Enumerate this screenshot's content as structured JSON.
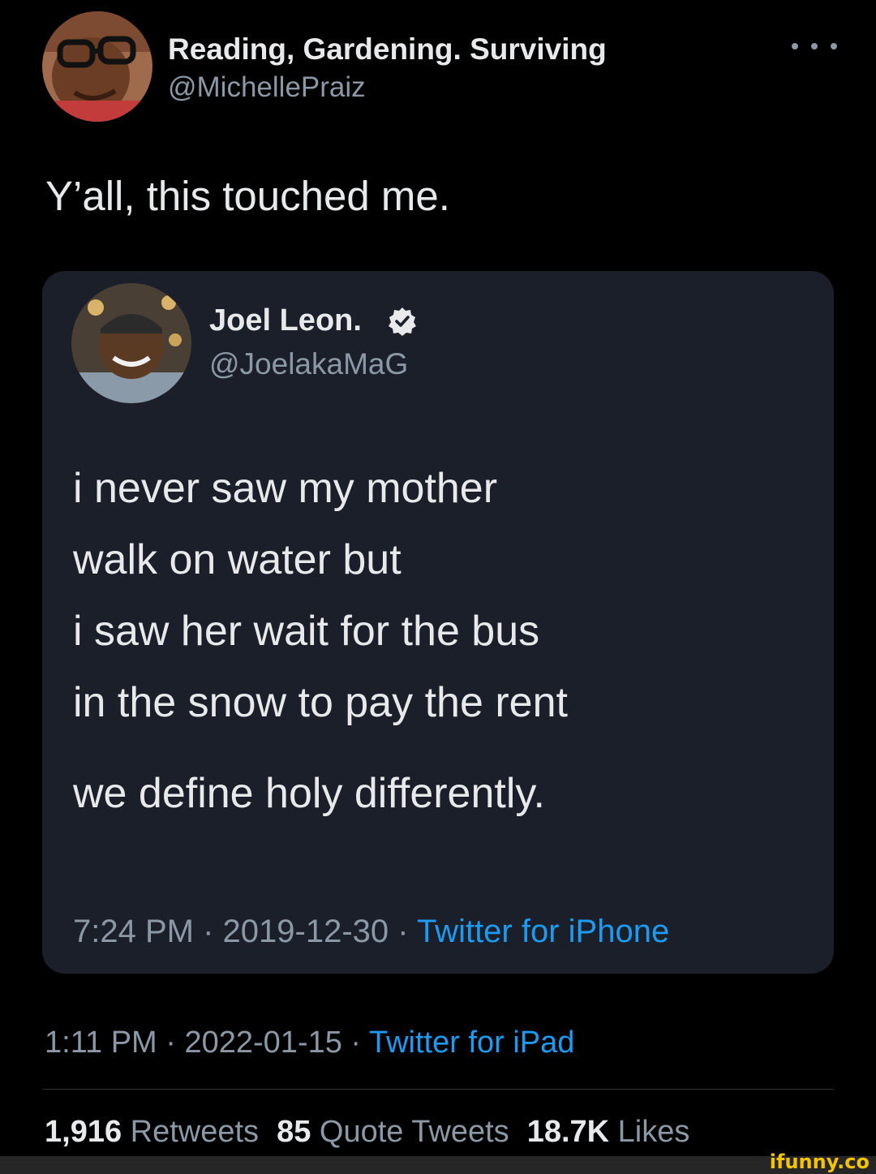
{
  "outer_tweet": {
    "author_name": "Reading, Gardening. Surviving",
    "author_handle": "@MichellePraiz",
    "text": "Y’all, this touched me.",
    "time": "1:11 PM",
    "separator": " · ",
    "date": "2022-01-15",
    "source": "Twitter for iPad",
    "avatar_icon": "user-avatar-photo",
    "more_icon": "more-options-icon"
  },
  "quoted_tweet": {
    "author_name": "Joel Leon.",
    "author_handle": "@JoelakaMaG",
    "verified_icon": "verified-badge-icon",
    "lines": [
      "i never saw my mother",
      "walk on water but",
      "i saw her wait for the bus",
      "in the snow to pay the rent",
      "we define holy differently."
    ],
    "time": "7:24 PM",
    "separator": " · ",
    "date": "2019-12-30",
    "source": "Twitter for iPhone"
  },
  "stats": {
    "retweets_count": "1,916",
    "retweets_label": "Retweets",
    "quotes_count": "85",
    "quotes_label": "Quote Tweets",
    "likes_count": "18.7K",
    "likes_label": "Likes"
  },
  "watermark": "ifunny.co",
  "colors": {
    "background": "#000000",
    "card": "#1b1f29",
    "text_primary": "#e7e9ea",
    "text_secondary": "#8b98a5",
    "link": "#1d9bf0",
    "watermark": "#f5c400"
  }
}
